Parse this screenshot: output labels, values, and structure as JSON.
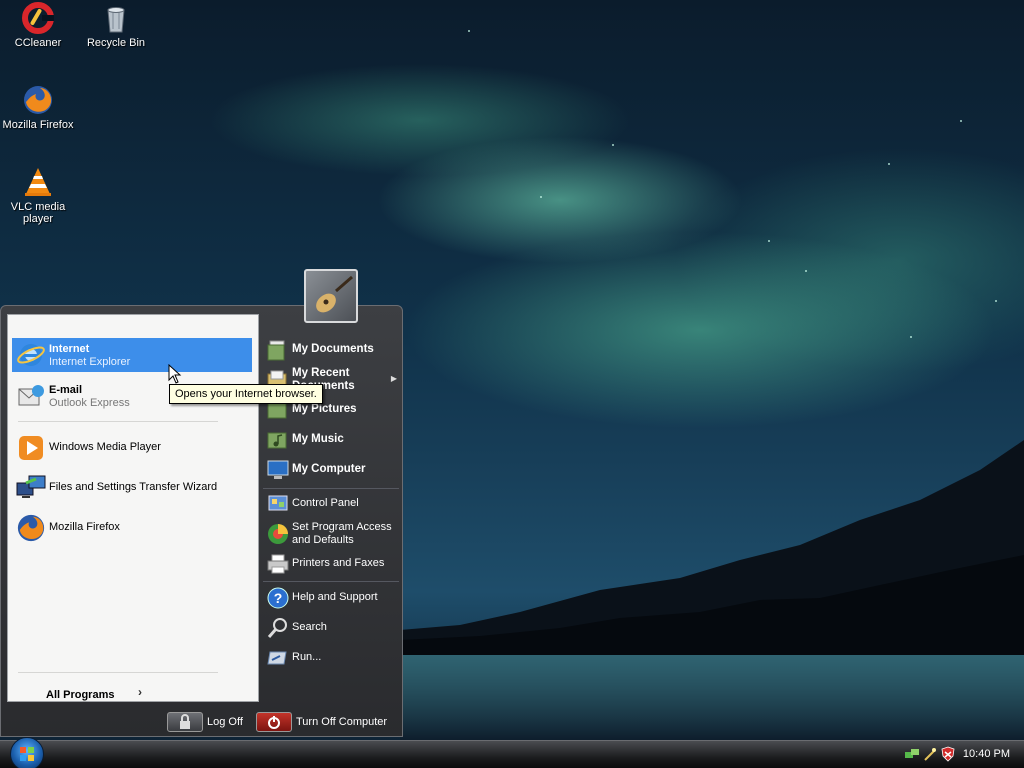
{
  "desktop_icons": [
    {
      "label": "CCleaner",
      "icon": "ccleaner-icon"
    },
    {
      "label": "Recycle Bin",
      "icon": "recycle-bin-icon"
    },
    {
      "label": "Mozilla Firefox",
      "icon": "firefox-icon"
    },
    {
      "label": "VLC media player",
      "icon": "vlc-icon"
    }
  ],
  "start_menu": {
    "pinned": [
      {
        "title": "Internet",
        "subtitle": "Internet Explorer",
        "icon": "internet-explorer-icon",
        "selected": true
      },
      {
        "title": "E-mail",
        "subtitle": "Outlook Express",
        "icon": "outlook-express-icon"
      }
    ],
    "recent": [
      {
        "title": "Windows Media Player",
        "icon": "windows-media-player-icon"
      },
      {
        "title": "Files and Settings Transfer Wizard",
        "icon": "transfer-wizard-icon"
      },
      {
        "title": "Mozilla Firefox",
        "icon": "firefox-icon"
      }
    ],
    "all_programs": "All Programs",
    "right": {
      "my_documents": "My Documents",
      "my_recent_documents": "My Recent Documents",
      "my_pictures": "My Pictures",
      "my_music": "My Music",
      "my_computer": "My Computer",
      "control_panel": "Control Panel",
      "set_program_access": "Set Program Access and Defaults",
      "printers_faxes": "Printers and Faxes",
      "help_support": "Help and Support",
      "search": "Search",
      "run": "Run..."
    },
    "log_off": "Log Off",
    "turn_off": "Turn Off Computer",
    "tooltip": "Opens your Internet browser."
  },
  "taskbar": {
    "clock": "10:40 PM",
    "colors": {
      "selection": "#3d8eea",
      "tooltip": "#ffffe1"
    }
  }
}
